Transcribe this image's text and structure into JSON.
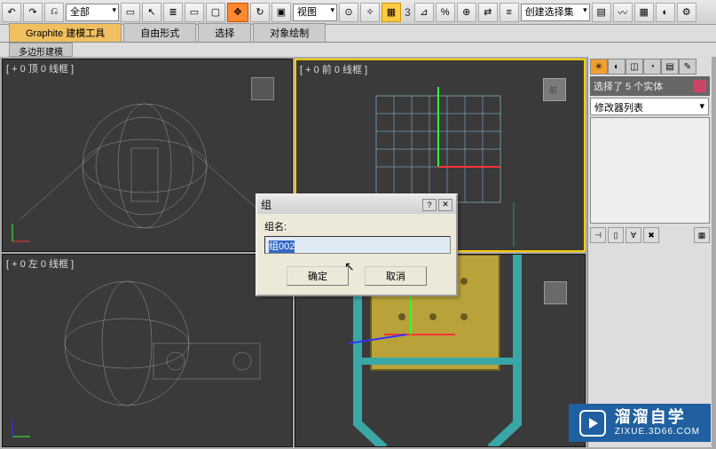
{
  "toolbar": {
    "filter_dropdown": "全部",
    "view_dropdown": "视图",
    "selection_set_dropdown": "创建选择集",
    "spin_value": "3"
  },
  "tabs": {
    "graphite": "Graphite 建模工具",
    "freeform": "自由形式",
    "select": "选择",
    "object_paint": "对象绘制",
    "poly_sub": "多边形建模"
  },
  "viewports": {
    "top": "[ + 0 顶 0 线框 ]",
    "front": "[ + 0 前 0 线框 ]",
    "left": "[ + 0 左 0 线框 ]",
    "persp_cube": "前"
  },
  "side": {
    "selection_status": "选择了 5 个实体",
    "modifier_list": "修改器列表"
  },
  "dialog": {
    "title": "组",
    "label": "组名:",
    "input_value": "组002",
    "ok": "确定",
    "cancel": "取消"
  },
  "watermark": {
    "main": "溜溜自学",
    "sub": "ZIXUE.3D66.COM"
  }
}
